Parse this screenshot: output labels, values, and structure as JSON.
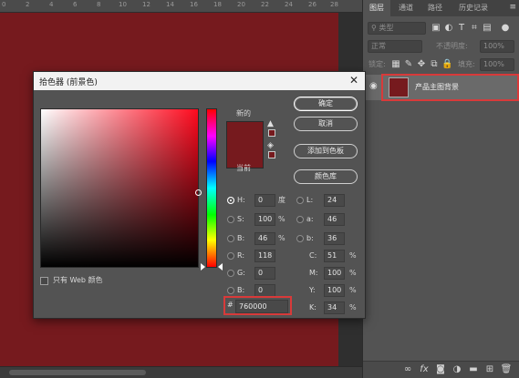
{
  "ruler": {
    "ticks": [
      "0",
      "2",
      "4",
      "6",
      "8",
      "10",
      "12",
      "14",
      "16",
      "18",
      "20",
      "22",
      "24",
      "26",
      "28"
    ]
  },
  "panel": {
    "tabs": [
      "图层",
      "通道",
      "路径",
      "历史记录"
    ],
    "menu_icon": "menu-icon",
    "filter_field": "类型",
    "blend_mode": "正常",
    "opacity_label": "不透明度:",
    "opacity_value": "100%",
    "lock_label": "锁定:",
    "fill_label": "填充:",
    "fill_value": "100%",
    "layer": {
      "name": "产品主图背景",
      "color": "#761a1e"
    },
    "bottom_icons": [
      "link-icon",
      "fx-icon",
      "mask-icon",
      "adjustment-icon",
      "folder-icon",
      "new-layer-icon",
      "trash-icon"
    ]
  },
  "dialog": {
    "title": "拾色器 (前景色)",
    "close": "✕",
    "new_label": "新的",
    "current_label": "当前",
    "buttons": {
      "ok": "确定",
      "cancel": "取消",
      "add_swatch": "添加到色板",
      "color_library": "颜色库"
    },
    "web_only_label": "只有 Web 颜色",
    "fields": {
      "H": {
        "label": "H:",
        "value": "0",
        "unit": "度",
        "checked": true
      },
      "S": {
        "label": "S:",
        "value": "100",
        "unit": "%"
      },
      "B": {
        "label": "B:",
        "value": "46",
        "unit": "%"
      },
      "R": {
        "label": "R:",
        "value": "118"
      },
      "G": {
        "label": "G:",
        "value": "0"
      },
      "Bb": {
        "label": "B:",
        "value": "0"
      },
      "L": {
        "label": "L:",
        "value": "24"
      },
      "a": {
        "label": "a:",
        "value": "46"
      },
      "b": {
        "label": "b:",
        "value": "36"
      },
      "C": {
        "label": "C:",
        "value": "51",
        "unit": "%"
      },
      "M": {
        "label": "M:",
        "value": "100",
        "unit": "%"
      },
      "Y": {
        "label": "Y:",
        "value": "100",
        "unit": "%"
      },
      "K": {
        "label": "K:",
        "value": "34",
        "unit": "%"
      }
    },
    "hex": {
      "hash": "#",
      "value": "760000"
    },
    "selected_color": "#761a1e"
  },
  "colors": {
    "canvas": "#761a1e",
    "highlight": "#d83a3a",
    "panel_bg": "#535353"
  }
}
